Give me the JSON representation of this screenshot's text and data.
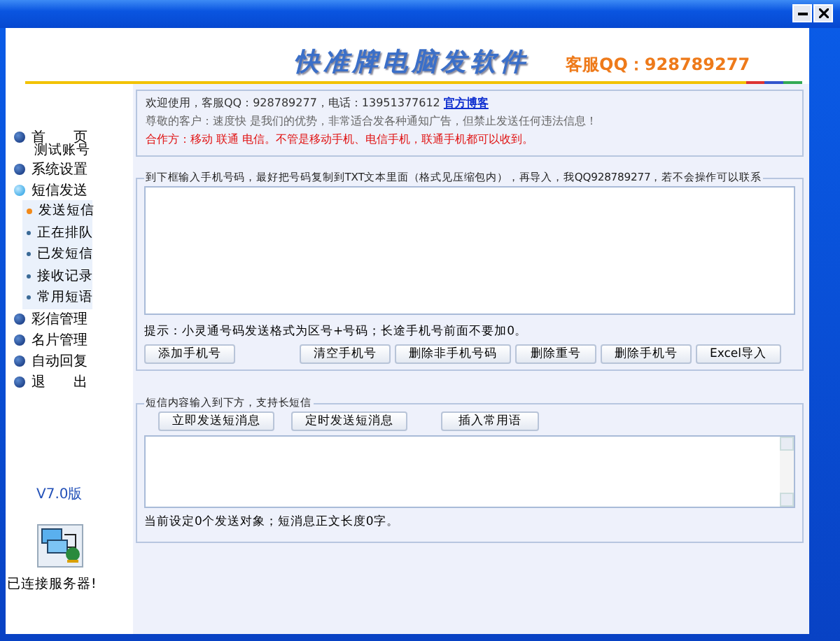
{
  "header": {
    "title": "快准牌电脑发软件",
    "contact": "客服QQ：928789277"
  },
  "sidebar": {
    "items": [
      {
        "label": "首　　页",
        "expanded": false
      },
      {
        "label": "测试账号"
      },
      {
        "label": "系统设置",
        "expanded": false
      },
      {
        "label": "短信发送",
        "expanded": true,
        "children": [
          {
            "label": "发送短信",
            "selected": true
          },
          {
            "label": "正在排队",
            "selected": false
          },
          {
            "label": "已发短信",
            "selected": false
          },
          {
            "label": "接收记录",
            "selected": false
          },
          {
            "label": "常用短语",
            "selected": false
          }
        ]
      },
      {
        "label": "彩信管理",
        "expanded": false
      },
      {
        "label": "名片管理",
        "expanded": false
      },
      {
        "label": "自动回复",
        "expanded": false
      },
      {
        "label": "退　　出",
        "expanded": false
      }
    ],
    "version": "V7.0版",
    "server_status": "已连接服务器!"
  },
  "notice": {
    "welcome": "欢迎使用，客服QQ：928789277，电话：13951377612",
    "blog_link": "官方博客",
    "line2": "尊敬的客户：速度快 是我们的优势，非常适合发各种通知广告，但禁止发送任何违法信息！",
    "line3": "合作方：移动 联通 电信。不管是移动手机、电信手机，联通手机都可以收到。"
  },
  "numbers": {
    "legend": "到下框输入手机号码，最好把号码复制到TXT文本里面（格式见压缩包内），再导入，我QQ928789277，若不会操作可以联系",
    "hint": "提示：小灵通号码发送格式为区号+号码；长途手机号前面不要加0。",
    "buttons": [
      "添加手机号",
      "清空手机号",
      "删除非手机号码",
      "删除重号",
      "删除手机号",
      "Excel导入"
    ]
  },
  "message": {
    "legend": "短信内容输入到下方，支持长短信",
    "buttons": [
      "立即发送短消息",
      "定时发送短消息",
      "插入常用语"
    ],
    "status": "当前设定0个发送对象；短消息正文长度0字。"
  }
}
